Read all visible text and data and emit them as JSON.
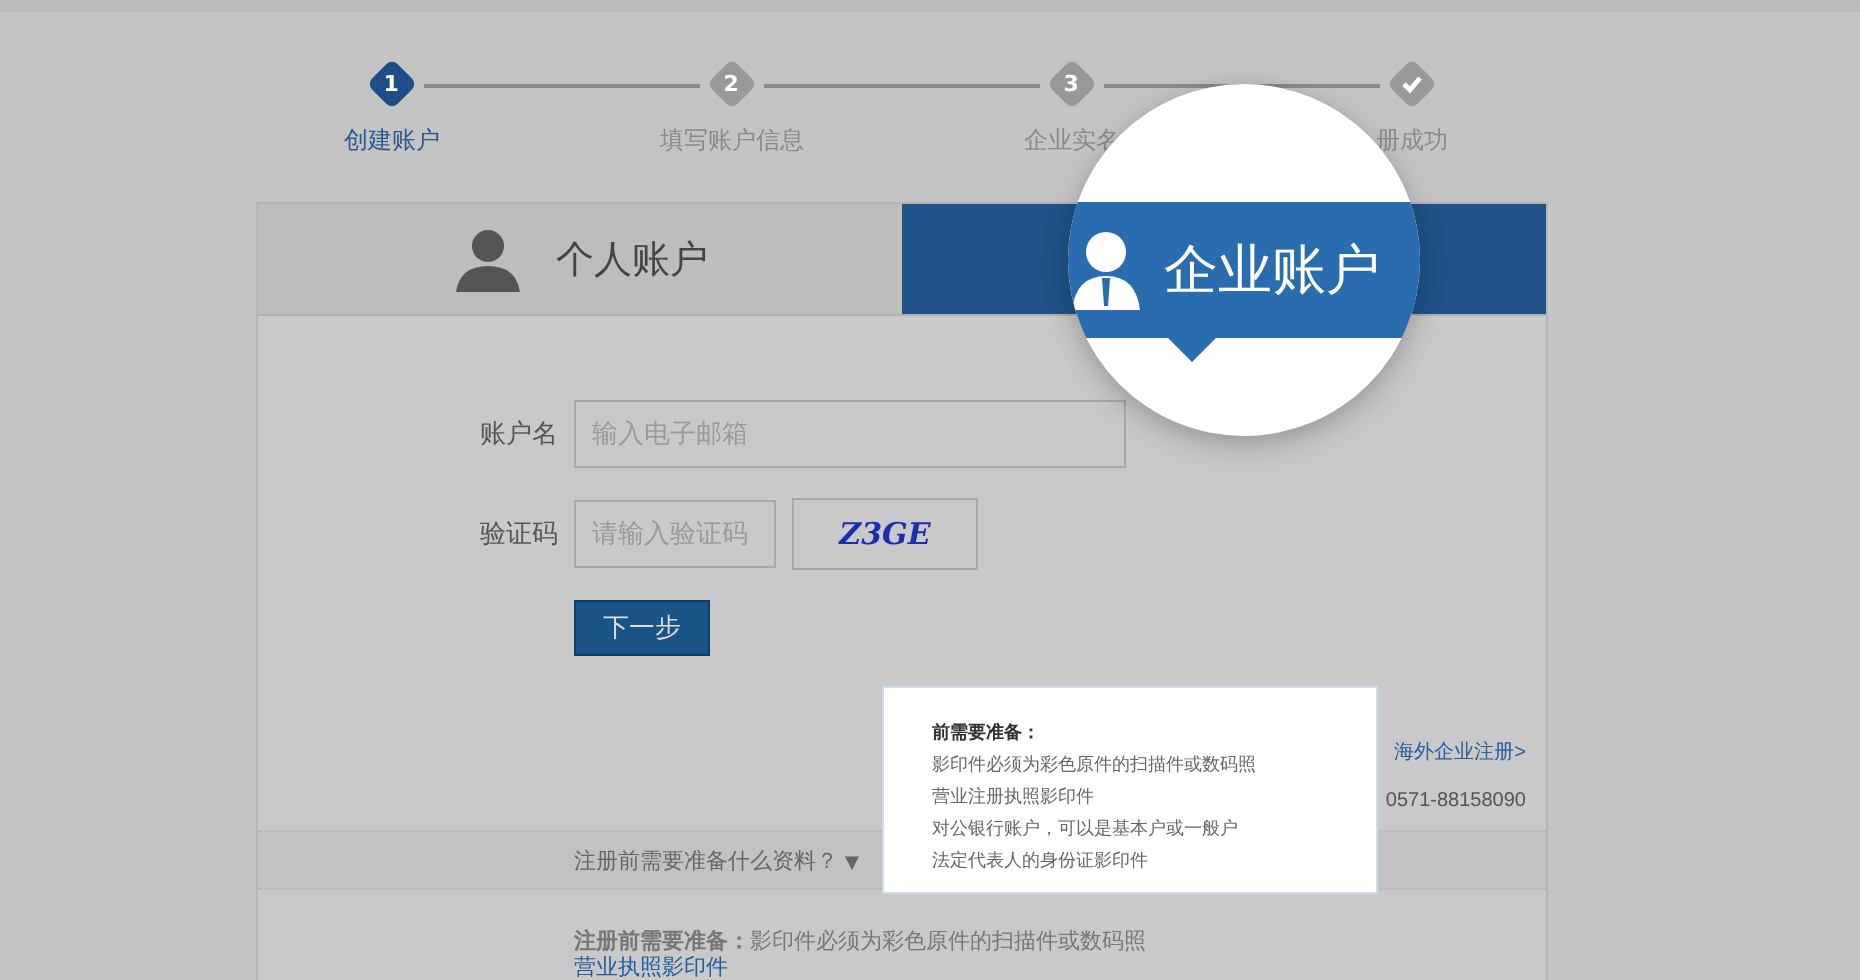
{
  "steps": [
    {
      "kind": "number",
      "icon_text": "1",
      "label": "创建账户",
      "selected": true
    },
    {
      "kind": "number",
      "icon_text": "2",
      "label": "填写账户信息",
      "selected": false
    },
    {
      "kind": "number",
      "icon_text": "3",
      "label": "企业实名",
      "selected": false
    },
    {
      "kind": "check",
      "label": "册成功",
      "selected": false
    }
  ],
  "tabs": [
    {
      "kind": "person",
      "label": "个人账户",
      "selected": false
    },
    {
      "kind": "business",
      "label": "企业账户",
      "selected": true
    }
  ],
  "form": {
    "account_label": "账户名",
    "account_placeholder": "输入电子邮箱",
    "captcha_label": "验证码",
    "captcha_placeholder": "请输入验证码",
    "captcha_text": "Z3GE",
    "next_button": "下一步"
  },
  "side_links": {
    "overseas_link": "海外企业注册>",
    "phone": "0571-88158090"
  },
  "faq_toggle": {
    "label": "注册前需要准备什么资料？",
    "arrow": "▼"
  },
  "tooltip": {
    "title": "前需要准备：",
    "lines": [
      "影印件必须为彩色原件的扫描件或数码照",
      "营业注册执照影印件",
      "对公银行账户，可以是基本户或一般户",
      "法定代表人的身份证影印件"
    ]
  },
  "requirements": {
    "text": "**注册前需要准备：**影印件必须为彩色原件的扫描件或数码照",
    "link": "营业执照影印件"
  }
}
